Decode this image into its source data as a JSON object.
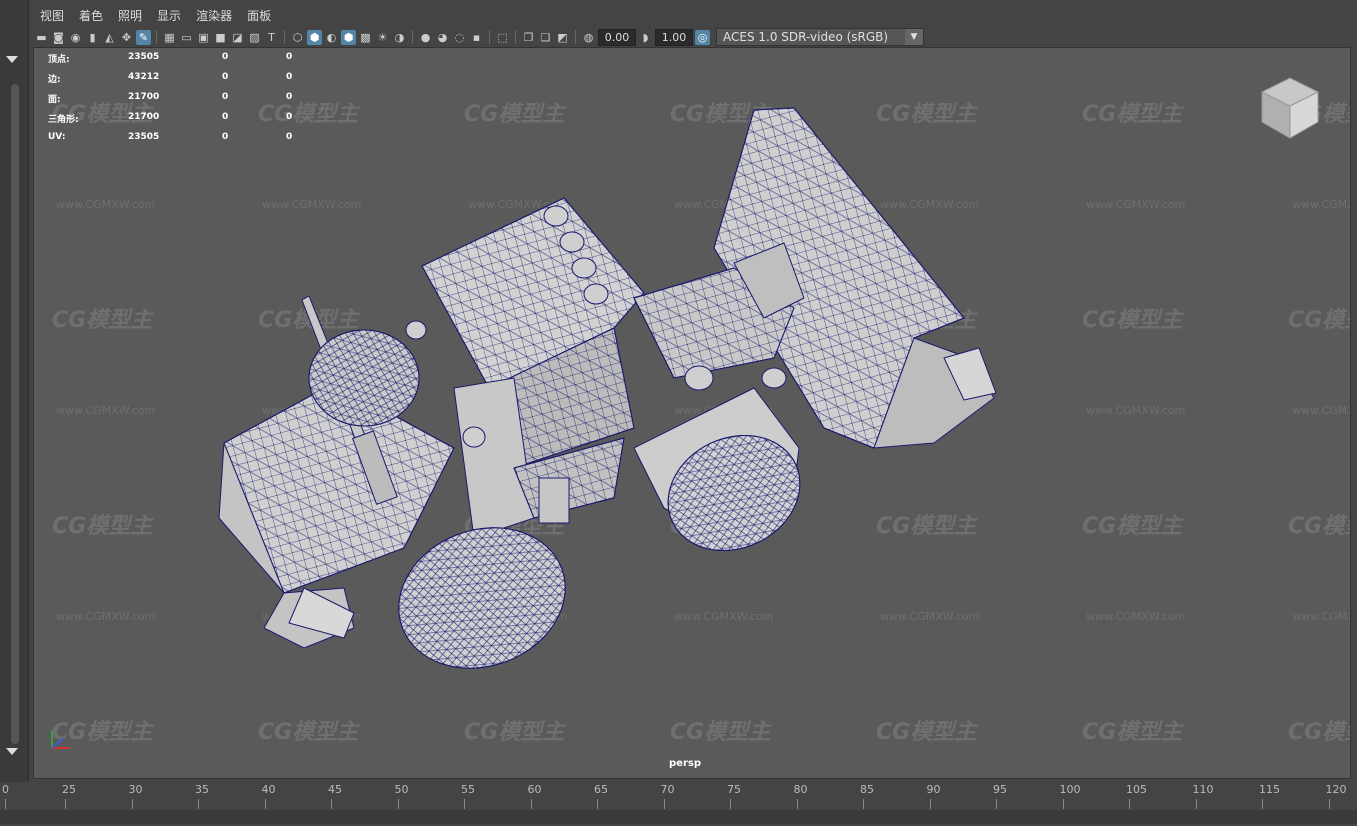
{
  "menu": [
    "视图",
    "着色",
    "照明",
    "显示",
    "渲染器",
    "面板"
  ],
  "toolbar": {
    "exposure": "0.00",
    "gamma": "1.00",
    "color_space": "ACES 1.0 SDR-video (sRGB)"
  },
  "hud": {
    "rows": [
      {
        "label": "顶点:",
        "v1": "23505",
        "v2": "0",
        "v3": "0"
      },
      {
        "label": "边:",
        "v1": "43212",
        "v2": "0",
        "v3": "0"
      },
      {
        "label": "面:",
        "v1": "21700",
        "v2": "0",
        "v3": "0"
      },
      {
        "label": "三角形:",
        "v1": "21700",
        "v2": "0",
        "v3": "0"
      },
      {
        "label": "UV:",
        "v1": "23505",
        "v2": "0",
        "v3": "0"
      }
    ]
  },
  "viewport": {
    "camera": "persp",
    "watermark": "CG模型主",
    "watermark_url": "www.CGMXW.com"
  },
  "timeline": {
    "ticks": [
      "0",
      "25",
      "30",
      "35",
      "40",
      "45",
      "50",
      "55",
      "60",
      "65",
      "70",
      "75",
      "80",
      "85",
      "90",
      "95",
      "100",
      "105",
      "110",
      "115",
      "120"
    ]
  },
  "colors": {
    "wire": "#1a1a6e",
    "mesh": "#cfcfcf",
    "viewport_bg": "#5a5a5a",
    "accent": "#5285a6"
  }
}
